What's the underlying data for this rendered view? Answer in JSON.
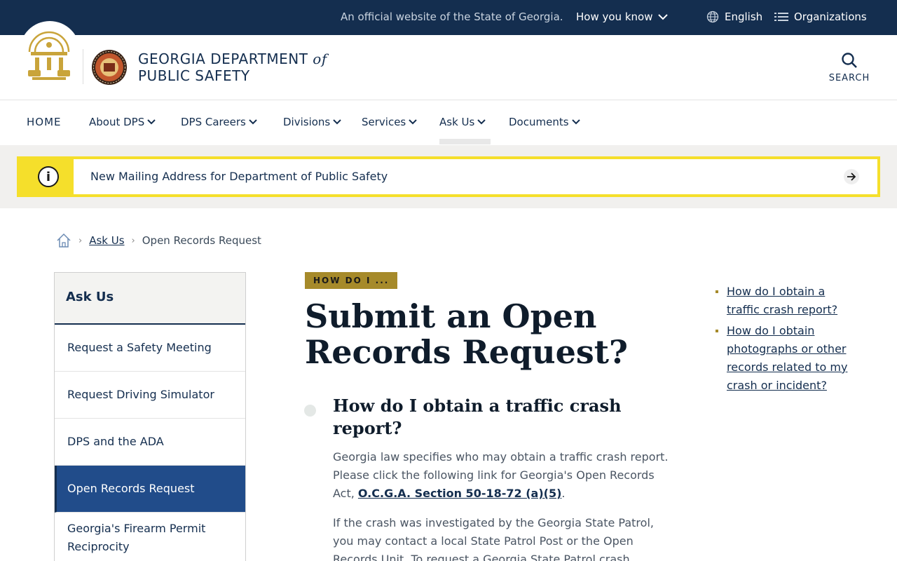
{
  "topbar": {
    "official_text": "An official website of the State of Georgia.",
    "how_you_know": "How you know",
    "language": "English",
    "organizations": "Organizations"
  },
  "header": {
    "agency_line1": "GEORGIA DEPARTMENT",
    "agency_of": "of",
    "agency_line2": "PUBLIC SAFETY",
    "search_label": "SEARCH"
  },
  "nav": {
    "items": [
      {
        "label": "HOME"
      },
      {
        "label": "About DPS"
      },
      {
        "label": "DPS Careers"
      },
      {
        "label": "Divisions"
      },
      {
        "label": "Services"
      },
      {
        "label": "Ask Us"
      },
      {
        "label": "Documents"
      }
    ],
    "active": "Ask Us"
  },
  "alert": {
    "message": "New Mailing Address for Department of Public Safety"
  },
  "breadcrumb": {
    "items": [
      "Ask Us",
      "Open Records Request"
    ]
  },
  "sidebar": {
    "heading": "Ask Us",
    "items": [
      {
        "label": "Request a Safety Meeting"
      },
      {
        "label": "Request Driving Simulator"
      },
      {
        "label": "DPS and the ADA"
      },
      {
        "label": "Open Records Request"
      },
      {
        "label": "Georgia's Firearm Permit Reciprocity"
      }
    ],
    "active": "Open Records Request"
  },
  "main": {
    "tag": "HOW DO I ...",
    "title": "Submit an Open Records Request?",
    "question1": "How do I obtain a traffic crash report?",
    "para1_text": "Georgia law specifies who may obtain a traffic crash report.  Please click the following link for Georgia's Open Records Act,",
    "para1_link": "O.C.G.A. Section 50-18-72 (a)(5)",
    "para1_end": ".",
    "para2_text": "If the crash was investigated by the Georgia State Patrol, you may contact a local State Patrol Post or the Open Records Unit.  To request a Georgia State Patrol crash"
  },
  "rail": {
    "links": [
      "How do I obtain a traffic crash report?",
      "How do I obtain photographs or other records related to my crash or incident?"
    ]
  },
  "colors": {
    "navy": "#142e4f",
    "gold": "#a68a2a",
    "alert_yellow": "#f5df2b",
    "active_blue": "#214c8a"
  }
}
